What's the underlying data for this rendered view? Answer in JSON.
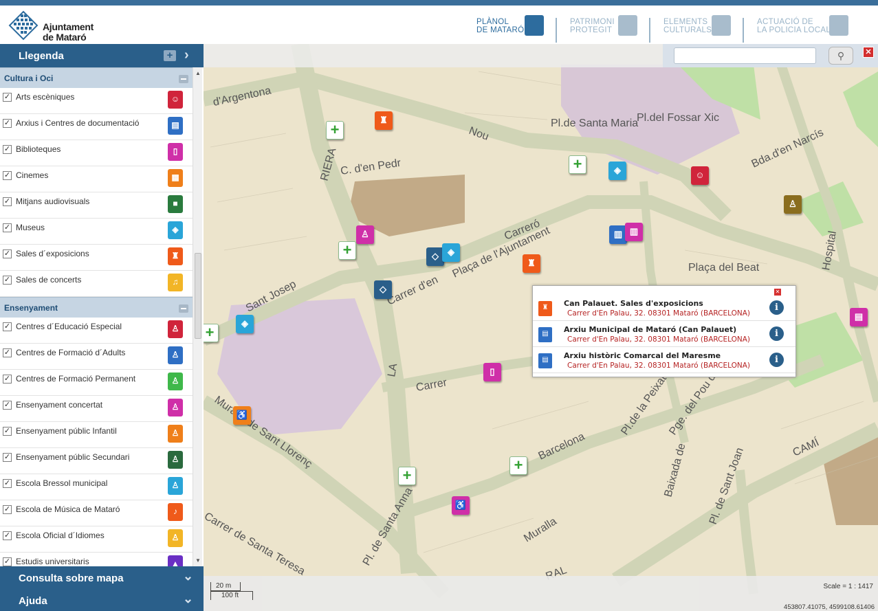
{
  "header": {
    "logo_line1": "Ajuntament",
    "logo_line2": "de Mataró",
    "tabs": [
      {
        "line1": "PLÀNOL",
        "line2": "DE MATARÓ",
        "active": true
      },
      {
        "line1": "PATRIMONI",
        "line2": "PROTEGIT",
        "active": false
      },
      {
        "line1": "ELEMENTS",
        "line2": "CULTURALS",
        "active": false
      },
      {
        "line1": "ACTUACIÓ DE",
        "line2": "LA POLICIA LOCAL",
        "active": false
      }
    ]
  },
  "sidebar": {
    "legend_title": "Llegenda",
    "categories": [
      {
        "name": "Cultura i Oci",
        "items": [
          {
            "label": "Arts escèniques",
            "icon": "theatre-masks-icon",
            "color": "#d0243b",
            "glyph": "☺"
          },
          {
            "label": "Arxius i Centres de documentació",
            "icon": "archive-icon",
            "color": "#2f6fc4",
            "glyph": "▤"
          },
          {
            "label": "Biblioteques",
            "icon": "book-icon",
            "color": "#cf2fa8",
            "glyph": "▯"
          },
          {
            "label": "Cinemes",
            "icon": "cinema-icon",
            "color": "#ef7f1a",
            "glyph": "▦"
          },
          {
            "label": "Mitjans audiovisuals",
            "icon": "camera-icon",
            "color": "#2a7b3e",
            "glyph": "■"
          },
          {
            "label": "Museus",
            "icon": "museum-icon",
            "color": "#2aa5d8",
            "glyph": "◈"
          },
          {
            "label": "Sales d´exposicions",
            "icon": "exhibition-icon",
            "color": "#ef5a1a",
            "glyph": "♜"
          },
          {
            "label": "Sales de concerts",
            "icon": "concert-icon",
            "color": "#f2b526",
            "glyph": "♫"
          }
        ]
      },
      {
        "name": "Ensenyament",
        "items": [
          {
            "label": "Centres d´Educació Especial",
            "icon": "special-education-icon",
            "color": "#d0243b",
            "glyph": "♙"
          },
          {
            "label": "Centres de Formació d´Adults",
            "icon": "adult-education-icon",
            "color": "#2f6fc4",
            "glyph": "♙"
          },
          {
            "label": "Centres de Formació Permanent",
            "icon": "permanent-education-icon",
            "color": "#3fb84a",
            "glyph": "♙"
          },
          {
            "label": "Ensenyament concertat",
            "icon": "concerted-school-icon",
            "color": "#cf2fa8",
            "glyph": "♙"
          },
          {
            "label": "Ensenyament públic Infantil",
            "icon": "infant-school-icon",
            "color": "#ef7f1a",
            "glyph": "♙"
          },
          {
            "label": "Ensenyament públic Secundari",
            "icon": "secondary-school-icon",
            "color": "#2a6a3e",
            "glyph": "♙"
          },
          {
            "label": "Escola Bressol municipal",
            "icon": "nursery-icon",
            "color": "#2aa5d8",
            "glyph": "♙"
          },
          {
            "label": "Escola de Música de Mataró",
            "icon": "music-school-icon",
            "color": "#ef5a1a",
            "glyph": "♪"
          },
          {
            "label": "Escola Oficial d´Idiomes",
            "icon": "language-school-icon",
            "color": "#f2b526",
            "glyph": "♙"
          },
          {
            "label": "Estudis universitaris",
            "icon": "university-icon",
            "color": "#6a2fc4",
            "glyph": "▲"
          }
        ]
      }
    ],
    "panel_query": "Consulta sobre mapa",
    "panel_help": "Ajuda"
  },
  "map": {
    "search_placeholder": "",
    "street_labels": [
      {
        "t": "d'Argentona"
      },
      {
        "t": "RIERA"
      },
      {
        "t": "C. d'en Pedr"
      },
      {
        "t": "Nou"
      },
      {
        "t": "Pl.de Santa Maria"
      },
      {
        "t": "Pl.del Fossar Xic"
      },
      {
        "t": "Plaça de l'Ajuntament"
      },
      {
        "t": "Carrer d'en"
      },
      {
        "t": "Carreró"
      },
      {
        "t": "Sant Josep"
      },
      {
        "t": "LA"
      },
      {
        "t": "Carrer"
      },
      {
        "t": "Muralla de Sant Llorenç"
      },
      {
        "t": "Carrer de Santa Teresa"
      },
      {
        "t": "Pl. de Santa Anna"
      },
      {
        "t": "Barcelona"
      },
      {
        "t": "Muralla"
      },
      {
        "t": "Pl.de la Peixateria"
      },
      {
        "t": "Pge. del Pou d'Avall"
      },
      {
        "t": "Baixada de"
      },
      {
        "t": "Pl. de Sant Joan"
      },
      {
        "t": "CAMÍ"
      },
      {
        "t": "RAL"
      },
      {
        "t": "Hospital"
      },
      {
        "t": "Bda.d'en Narcís"
      },
      {
        "t": "Plaça del Beat"
      }
    ],
    "scale_m": "20 m",
    "scale_ft": "100 ft",
    "scale_text": "Scale = 1 : 1417",
    "coords": "453807.41075, 4599108.61406"
  },
  "popup": {
    "rows": [
      {
        "title": "Can Palauet. Sales d'exposicions",
        "address": "Carrer d'En Palau, 32. 08301 Mataró (BARCELONA)",
        "color": "#ef5a1a",
        "icon": "exhibition-icon"
      },
      {
        "title": "Arxiu Municipal de Mataró (Can Palauet)",
        "address": "Carrer d'En Palau, 32. 08301 Mataró (BARCELONA)",
        "color": "#2f6fc4",
        "icon": "archive-icon"
      },
      {
        "title": "Arxiu històric Comarcal del Maresme",
        "address": "Carrer d'En Palau, 32. 08301 Mataró (BARCELONA)",
        "color": "#2f6fc4",
        "icon": "archive-icon"
      }
    ]
  }
}
